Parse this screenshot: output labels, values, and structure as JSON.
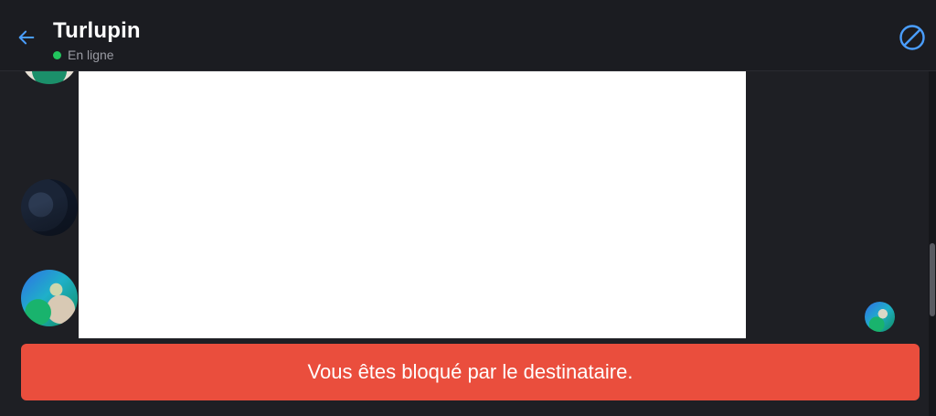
{
  "header": {
    "contact_name": "Turlupin",
    "status": "En ligne",
    "back_icon": "arrow-left-icon",
    "block_icon": "block-icon"
  },
  "conversation": {
    "image_message": {
      "background": "#ffffff"
    }
  },
  "banner": {
    "text": "Vous êtes bloqué par le destinataire."
  },
  "colors": {
    "accent": "#4a9eff",
    "online": "#22c55e",
    "danger": "#ea4e3d",
    "background": "#1e1f24"
  }
}
